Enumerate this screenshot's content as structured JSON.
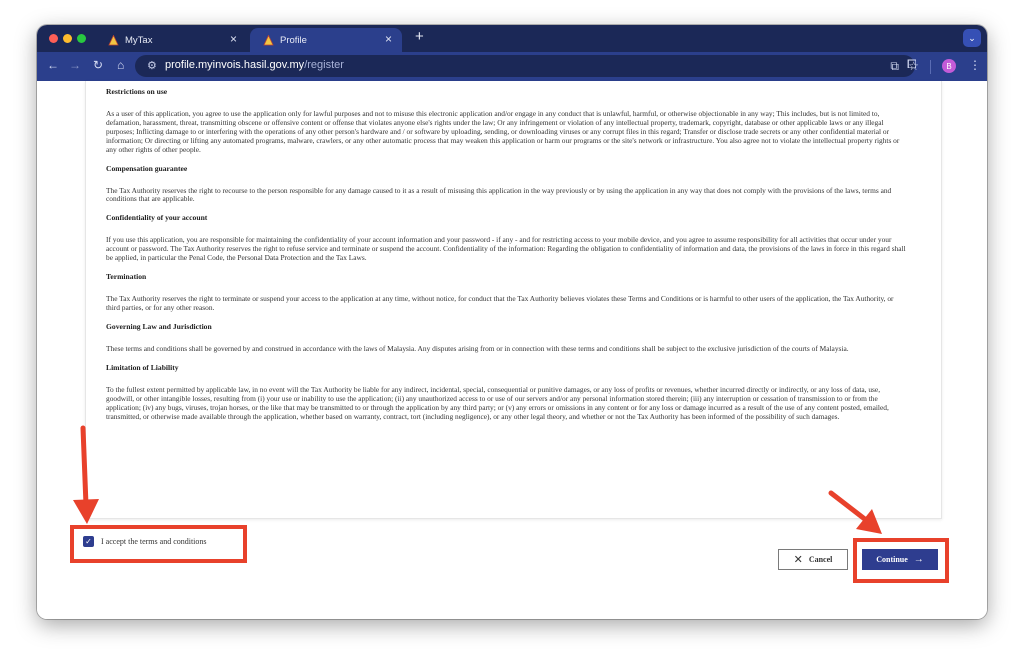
{
  "browser": {
    "tabs": [
      {
        "label": "MyTax",
        "active": false
      },
      {
        "label": "Profile",
        "active": true
      }
    ],
    "new_tab_symbol": "+",
    "close_symbol": "×",
    "url_host": "profile.myinvois.hasil.gov.my",
    "url_path": "/register",
    "profile_initial": "B",
    "colors": {
      "tabbar": "#1b2857",
      "toolbar": "#2b3f8c",
      "accent": "#2e3d8f",
      "annotation": "#e8412b"
    }
  },
  "terms": {
    "sections": [
      {
        "heading": "Restrictions on use",
        "body": "As a user of this application, you agree to use the application only for lawful purposes and not to misuse this electronic application and/or engage in any conduct that is unlawful, harmful, or otherwise objectionable in any way; This includes, but is not limited to, defamation, harassment, threat, transmitting obscene or offensive content or offense that violates anyone else's rights under the law; Or any infringement or violation of any intellectual property, trademark, copyright, database or other applicable laws or any illegal purposes; Inflicting damage to or interfering with the operations of any other person's hardware and / or software by uploading, sending, or downloading viruses or any corrupt files in this regard; Transfer or disclose trade secrets or any other confidential material or information; Or directing or lifting any automated programs, malware, crawlers, or any other automatic process that may weaken this application or harm our programs or the site's network or infrastructure. You also agree not to violate the intellectual property rights or any other rights of other people."
      },
      {
        "heading": "Compensation guarantee",
        "body": "The Tax Authority reserves the right to recourse to the person responsible for any damage caused to it as a result of misusing this application in the way previously or by using the application in any way that does not comply with the provisions of the laws, terms and conditions that are applicable."
      },
      {
        "heading": "Confidentiality of your account",
        "body": "If you use this application, you are responsible for maintaining the confidentiality of your account information and your password - if any - and for restricting access to your mobile device, and you agree to assume responsibility for all activities that occur under your account or password. The Tax Authority reserves the right to refuse service and terminate or suspend the account. Confidentiality of the information: Regarding the obligation to confidentiality of information and data, the provisions of the laws in force in this regard shall be applied, in particular the Penal Code, the Personal Data Protection and the Tax Laws."
      },
      {
        "heading": "Termination",
        "body": "The Tax Authority reserves the right to terminate or suspend your access to the application at any time, without notice, for conduct that the Tax Authority believes violates these Terms and Conditions or is harmful to other users of the application, the Tax Authority, or third parties, or for any other reason."
      },
      {
        "heading": "Governing Law and Jurisdiction",
        "body": "These terms and conditions shall be governed by and construed in accordance with the laws of Malaysia. Any disputes arising from or in connection with these terms and conditions shall be subject to the exclusive jurisdiction of the courts of Malaysia."
      },
      {
        "heading": "Limitation of Liability",
        "body": "To the fullest extent permitted by applicable law, in no event will the Tax Authority be liable for any indirect, incidental, special, consequential or punitive damages, or any loss of profits or revenues, whether incurred directly or indirectly, or any loss of data, use, goodwill, or other intangible losses, resulting from (i) your use or inability to use the application; (ii) any unauthorized access to or use of our servers and/or any personal information stored therein; (iii) any interruption or cessation of transmission to or from the application; (iv) any bugs, viruses, trojan horses, or the like that may be transmitted to or through the application by any third party; or (v) any errors or omissions in any content or for any loss or damage incurred as a result of the use of any content posted, emailed, transmitted, or otherwise made available through the application, whether based on warranty, contract, tort (including negligence), or any other legal theory, and whether or not the Tax Authority has been informed of the possibility of such damages."
      }
    ]
  },
  "accept": {
    "label": "I accept the terms and conditions",
    "checked": true
  },
  "actions": {
    "cancel_label": "Cancel",
    "continue_label": "Continue"
  }
}
